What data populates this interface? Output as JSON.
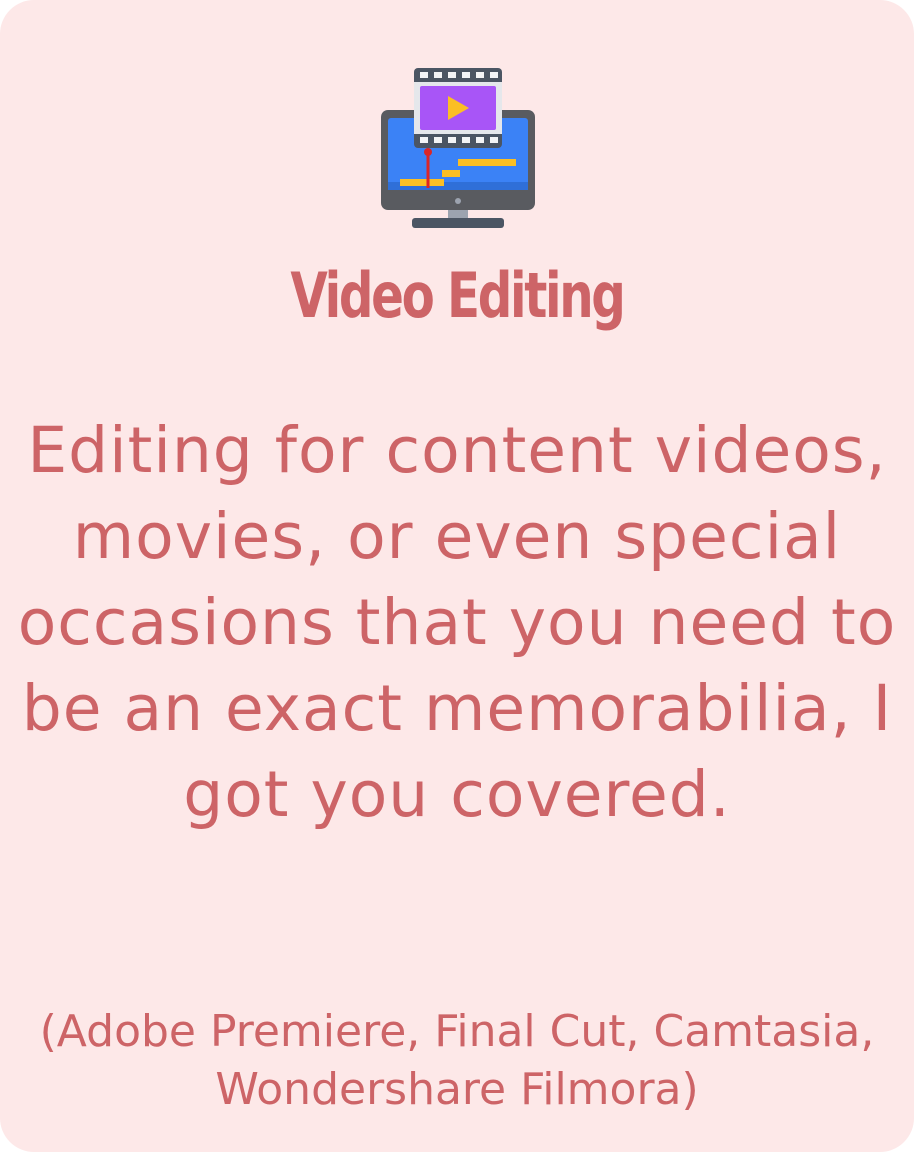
{
  "card": {
    "title": "Video Editing",
    "description": "Editing for content videos, movies, or even special occasions that you need to be an exact memorabilia, I got you covered.",
    "tools": "(Adobe Premiere, Final Cut, Camtasia, Wondershare Filmora)",
    "icon": "video-editing-monitor-icon"
  },
  "colors": {
    "background": "#fde8e8",
    "text": "#cd6467",
    "monitor_frame": "#595b60",
    "monitor_screen": "#3b82f6",
    "film_strip": "#4b5563",
    "film_frame": "#a855f7",
    "accent_yellow": "#fbbf24"
  }
}
